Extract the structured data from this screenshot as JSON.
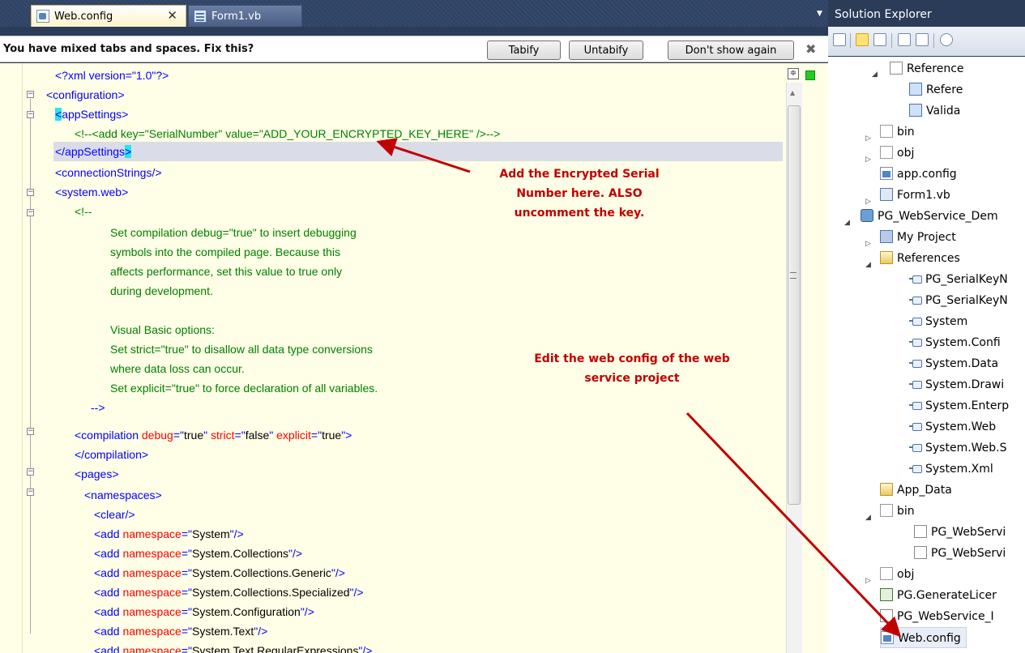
{
  "tabs": [
    {
      "label": "Web.config",
      "active": true
    },
    {
      "label": "Form1.vb",
      "active": false
    }
  ],
  "infobar": {
    "message": "You have mixed tabs and spaces. Fix this?",
    "tabify": "Tabify",
    "untabify": "Untabify",
    "dont_show": "Don't show again"
  },
  "code_lines": [
    "<?xml version=\"1.0\"?>",
    "<configuration>",
    "<appSettings>",
    "<!--<add key=\"SerialNumber\" value=\"ADD_YOUR_ENCRYPTED_KEY_HERE\" />-->",
    "</appSettings>",
    "<connectionStrings/>",
    "<system.web>",
    "<!--",
    "Set compilation debug=\"true\" to insert debugging",
    "symbols into the compiled page. Because this",
    "affects performance, set this value to true only",
    "during development.",
    "",
    "Visual Basic options:",
    "Set strict=\"true\" to disallow all data type conversions",
    "where data loss can occur.",
    "Set explicit=\"true\" to force declaration of all variables.",
    "-->",
    "<compilation debug=\"true\" strict=\"false\" explicit=\"true\">",
    "</compilation>",
    "<pages>",
    "<namespaces>",
    "<clear/>",
    "<add namespace=\"System\"/>",
    "<add namespace=\"System.Collections\"/>",
    "<add namespace=\"System.Collections.Generic\"/>",
    "<add namespace=\"System.Collections.Specialized\"/>",
    "<add namespace=\"System.Configuration\"/>",
    "<add namespace=\"System.Text\"/>",
    "<add namespace=\"System.Text.RegularExpressions\"/>"
  ],
  "annotations": {
    "note1": [
      "Add the Encrypted Serial",
      "Number here.  ALSO",
      "uncomment the key."
    ],
    "note2": [
      "Edit the web config of the web",
      "service project"
    ],
    "accent_color": "#c00000"
  },
  "solution_explorer": {
    "title": "Solution Explorer",
    "items": [
      {
        "label": "Reference",
        "icon": "doc-icon"
      },
      {
        "label": "Refere",
        "icon": "reference-icon"
      },
      {
        "label": "Valida",
        "icon": "reference-icon"
      },
      {
        "label": "bin",
        "icon": "folder-empty-icon"
      },
      {
        "label": "obj",
        "icon": "folder-empty-icon"
      },
      {
        "label": "app.config",
        "icon": "config-icon"
      },
      {
        "label": "Form1.vb",
        "icon": "form-icon"
      },
      {
        "label": "PG_WebService_Dem",
        "icon": "project-icon"
      },
      {
        "label": "My Project",
        "icon": "my-project-icon"
      },
      {
        "label": "References",
        "icon": "folder-open-icon"
      },
      {
        "label": "PG_SerialKeyN",
        "icon": "ref-bullet-icon"
      },
      {
        "label": "PG_SerialKeyN",
        "icon": "ref-bullet-icon"
      },
      {
        "label": "System",
        "icon": "ref-bullet-icon"
      },
      {
        "label": "System.Confi",
        "icon": "ref-bullet-icon"
      },
      {
        "label": "System.Data",
        "icon": "ref-bullet-icon"
      },
      {
        "label": "System.Drawi",
        "icon": "ref-bullet-icon"
      },
      {
        "label": "System.Enterp",
        "icon": "ref-bullet-icon"
      },
      {
        "label": "System.Web",
        "icon": "ref-bullet-icon"
      },
      {
        "label": "System.Web.S",
        "icon": "ref-bullet-icon"
      },
      {
        "label": "System.Xml",
        "icon": "ref-bullet-icon"
      },
      {
        "label": "App_Data",
        "icon": "folder-icon"
      },
      {
        "label": "bin",
        "icon": "folder-open-icon"
      },
      {
        "label": "PG_WebServi",
        "icon": "doc-icon"
      },
      {
        "label": "PG_WebServi",
        "icon": "doc-icon"
      },
      {
        "label": "obj",
        "icon": "folder-empty-icon"
      },
      {
        "label": "PG.GenerateLicer",
        "icon": "vb-file-icon"
      },
      {
        "label": "PG_WebService_I",
        "icon": "doc-icon"
      },
      {
        "label": "Web.config",
        "icon": "config-icon"
      }
    ]
  }
}
